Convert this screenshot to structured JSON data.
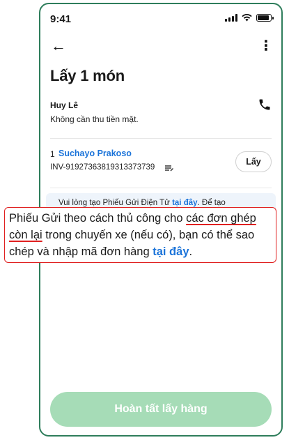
{
  "status_bar": {
    "time": "9:41"
  },
  "nav": {
    "back_icon": "←",
    "more_icon": "⋮"
  },
  "page": {
    "title": "Lấy 1 món"
  },
  "customer": {
    "name": "Huy Lê",
    "note": "Không cần thu tiền mặt."
  },
  "item": {
    "index": "1",
    "name": "Suchayo Prakoso",
    "invoice": "INV-919273638193133​73739",
    "pick_label": "Lấy"
  },
  "info_banner": {
    "text": "Vui lòng tạo Phiếu Gửi Điện Tử ",
    "link": "tại đây",
    "suffix": ". Để tạo"
  },
  "zoom_callout": {
    "line1_prefix": "Phiếu Gửi theo cách thủ công cho ",
    "line1_underlined": "các đơn ghép",
    "line2_underlined": "còn lại",
    "line2_suffix": " trong chuyến xe (nếu có), bạn có thể sao",
    "line3_prefix": "chép và nhập mã đơn hàng ",
    "line3_link": "tại đây",
    "line3_suffix": "."
  },
  "footer": {
    "complete_label": "Hoàn tất lấy hàng"
  },
  "colors": {
    "accent_blue": "#1a73d9",
    "disabled_green": "#a6dcb7",
    "highlight_red": "#e02020",
    "frame_green": "#2e7d5b"
  }
}
